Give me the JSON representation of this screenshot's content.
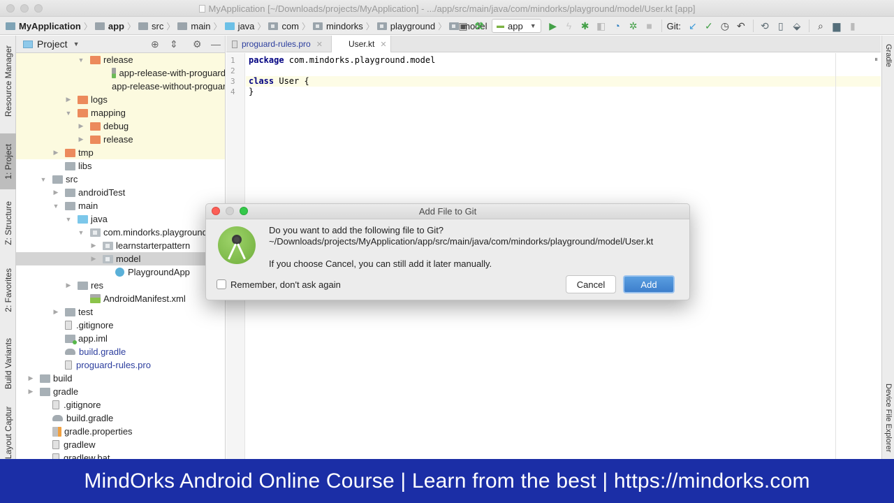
{
  "window": {
    "title": "MyApplication [~/Downloads/projects/MyApplication] - .../app/src/main/java/com/mindorks/playground/model/User.kt [app]"
  },
  "breadcrumbs": [
    "MyApplication",
    "app",
    "src",
    "main",
    "java",
    "com",
    "mindorks",
    "playground",
    "model"
  ],
  "toolbar": {
    "run_config": "app",
    "git_label": "Git:",
    "icons": [
      "layout-icon",
      "build-hammer-icon",
      "run-icon",
      "apply-changes-icon",
      "debug-icon",
      "coverage-icon",
      "profile-icon",
      "attach-debugger-icon",
      "stop-icon",
      "git-update-icon",
      "git-commit-icon",
      "git-history-icon",
      "git-revert-icon",
      "gradle-sync-icon",
      "avd-manager-icon",
      "sdk-manager-icon",
      "search-icon",
      "project-structure-icon",
      "user-icon"
    ]
  },
  "left_stripe": {
    "tabs": [
      "Resource Manager",
      "1: Project",
      "Z: Structure",
      "2: Favorites",
      "Build Variants",
      "Layout Captures"
    ],
    "active": "1: Project"
  },
  "project_panel": {
    "title": "Project",
    "tree": [
      {
        "label": "release",
        "icon": "orange",
        "arrow": "down",
        "depth": 5,
        "excluded": true
      },
      {
        "label": "app-release-with-proguard",
        "icon": "apk",
        "arrow": "",
        "depth": 7,
        "excluded": true
      },
      {
        "label": "app-release-without-proguard",
        "icon": "apk",
        "arrow": "",
        "depth": 7,
        "excluded": true
      },
      {
        "label": "logs",
        "icon": "orange",
        "arrow": "right",
        "depth": 4,
        "excluded": true
      },
      {
        "label": "mapping",
        "icon": "orange",
        "arrow": "down",
        "depth": 4,
        "excluded": true
      },
      {
        "label": "debug",
        "icon": "orange",
        "arrow": "right",
        "depth": 5,
        "excluded": true
      },
      {
        "label": "release",
        "icon": "orange",
        "arrow": "right",
        "depth": 5,
        "excluded": true
      },
      {
        "label": "tmp",
        "icon": "orange",
        "arrow": "right",
        "depth": 3,
        "excluded": true
      },
      {
        "label": "libs",
        "icon": "gray",
        "arrow": "",
        "depth": 3
      },
      {
        "label": "src",
        "icon": "gray",
        "arrow": "down",
        "depth": 2
      },
      {
        "label": "androidTest",
        "icon": "gray",
        "arrow": "right",
        "depth": 3
      },
      {
        "label": "main",
        "icon": "gray",
        "arrow": "down",
        "depth": 3
      },
      {
        "label": "java",
        "icon": "blue",
        "arrow": "down",
        "depth": 4
      },
      {
        "label": "com.mindorks.playground",
        "icon": "pkg",
        "arrow": "down",
        "depth": 5
      },
      {
        "label": "learnstarterpattern",
        "icon": "pkg",
        "arrow": "right",
        "depth": 6
      },
      {
        "label": "model",
        "icon": "pkg",
        "arrow": "right",
        "depth": 6,
        "selected": true
      },
      {
        "label": "PlaygroundApp",
        "icon": "kt",
        "arrow": "",
        "depth": 7
      },
      {
        "label": "res",
        "icon": "gray",
        "arrow": "right",
        "depth": 4
      },
      {
        "label": "AndroidManifest.xml",
        "icon": "mf",
        "arrow": "",
        "depth": 5
      },
      {
        "label": "test",
        "icon": "gray",
        "arrow": "right",
        "depth": 3
      },
      {
        "label": ".gitignore",
        "icon": "doc",
        "arrow": "",
        "depth": 3
      },
      {
        "label": "app.iml",
        "icon": "iml",
        "arrow": "",
        "depth": 3
      },
      {
        "label": "build.gradle",
        "icon": "gradle",
        "arrow": "",
        "depth": 3,
        "vcs": true
      },
      {
        "label": "proguard-rules.pro",
        "icon": "doc",
        "arrow": "",
        "depth": 3,
        "vcs": true
      },
      {
        "label": "build",
        "icon": "gray",
        "arrow": "right",
        "depth": 1
      },
      {
        "label": "gradle",
        "icon": "gray",
        "arrow": "right",
        "depth": 1
      },
      {
        "label": ".gitignore",
        "icon": "doc",
        "arrow": "",
        "depth": 2
      },
      {
        "label": "build.gradle",
        "icon": "gradle",
        "arrow": "",
        "depth": 2
      },
      {
        "label": "gradle.properties",
        "icon": "props",
        "arrow": "",
        "depth": 2
      },
      {
        "label": "gradlew",
        "icon": "doc",
        "arrow": "",
        "depth": 2
      },
      {
        "label": "gradlew.bat",
        "icon": "doc",
        "arrow": "",
        "depth": 2
      }
    ]
  },
  "editor": {
    "tabs": [
      {
        "label": "proguard-rules.pro",
        "active": false
      },
      {
        "label": "User.kt",
        "active": true
      }
    ],
    "lines": [
      {
        "num": "1",
        "kw": "package",
        "rest": " com.mindorks.playground.model"
      },
      {
        "num": "2",
        "kw": "",
        "rest": ""
      },
      {
        "num": "3",
        "kw": "class",
        "rest": " User {"
      },
      {
        "num": "4",
        "kw": "",
        "rest": "}"
      }
    ]
  },
  "right_stripe": {
    "tabs": [
      "Gradle",
      "Device File Explorer"
    ]
  },
  "dialog": {
    "title": "Add File to Git",
    "question": "Do you want to add the following file to Git?",
    "path": "~/Downloads/projects/MyApplication/app/src/main/java/com/mindorks/playground/model/User.kt",
    "note": "If you choose Cancel, you can still add it later manually.",
    "checkbox_label": "Remember, don't ask again",
    "checkbox_checked": false,
    "cancel_label": "Cancel",
    "add_label": "Add"
  },
  "banner": {
    "text": "MindOrks Android Online Course | Learn from the best | https://mindorks.com"
  },
  "colors": {
    "banner_bg": "#1b2ea6",
    "primary_button": "#3d7fcc",
    "excluded_bg": "#fcfadf",
    "vcs_text": "#2c3e9e"
  }
}
